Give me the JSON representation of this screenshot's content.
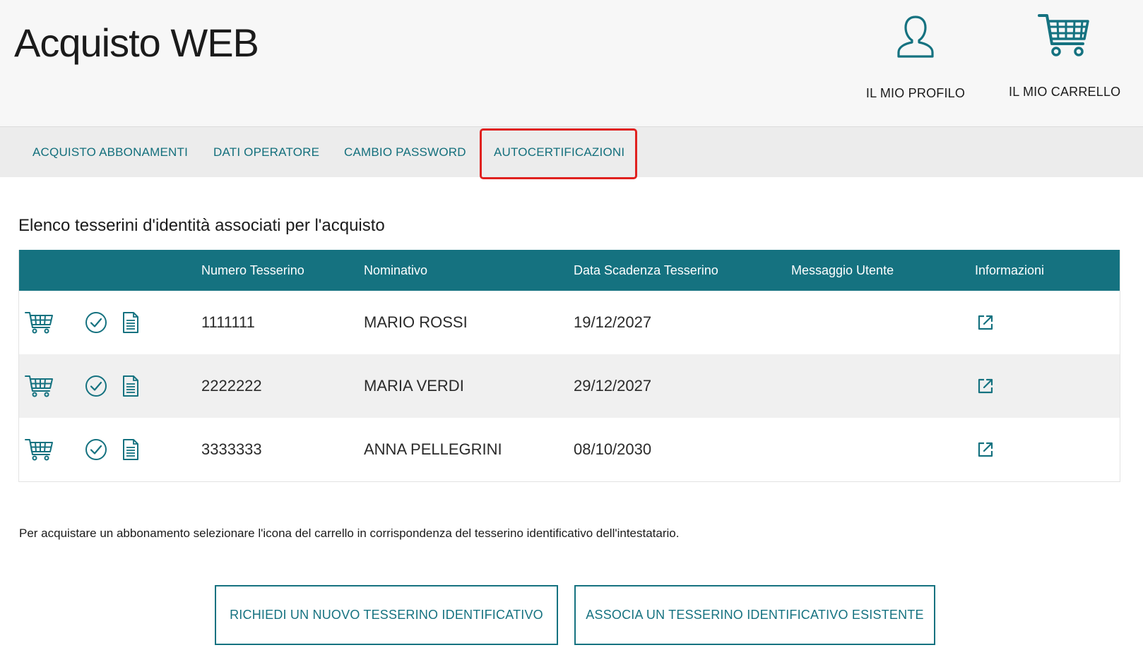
{
  "app": {
    "title": "Acquisto WEB"
  },
  "header": {
    "profile_label": "IL MIO PROFILO",
    "profile_icon": "user-icon",
    "cart_label": "IL MIO CARRELLO",
    "cart_icon": "shopping-cart-icon"
  },
  "nav": {
    "items": [
      {
        "label": "ACQUISTO ABBONAMENTI"
      },
      {
        "label": "DATI OPERATORE"
      },
      {
        "label": "CAMBIO PASSWORD"
      },
      {
        "label": "AUTOCERTIFICAZIONI",
        "highlighted": true
      }
    ]
  },
  "section": {
    "title": "Elenco tesserini d'identità associati per l'acquisto"
  },
  "table": {
    "columns": [
      "Numero Tesserino",
      "Nominativo",
      "Data Scadenza Tesserino",
      "Messaggio Utente",
      "Informazioni"
    ],
    "rows": [
      {
        "numero": "1111111",
        "nominativo": "MARIO ROSSI",
        "scadenza": "19/12/2027",
        "messaggio": ""
      },
      {
        "numero": "2222222",
        "nominativo": "MARIA VERDI",
        "scadenza": "29/12/2027",
        "messaggio": ""
      },
      {
        "numero": "3333333",
        "nominativo": "ANNA PELLEGRINI",
        "scadenza": "08/10/2030",
        "messaggio": ""
      }
    ],
    "row_icons": [
      "cart-icon",
      "check-circle-icon",
      "document-icon"
    ],
    "info_icon": "external-link-icon"
  },
  "help_text": "Per acquistare un abbonamento selezionare l'icona del carrello in corrispondenza del tesserino identificativo dell'intestatario.",
  "buttons": {
    "new_card": "RICHIEDI UN NUOVO TESSERINO IDENTIFICATIVO",
    "associate_card": "ASSOCIA UN TESSERINO IDENTIFICATIVO ESISTENTE"
  },
  "colors": {
    "accent": "#157280",
    "nav_text": "#136f7c",
    "highlight_border": "#e0211f"
  }
}
